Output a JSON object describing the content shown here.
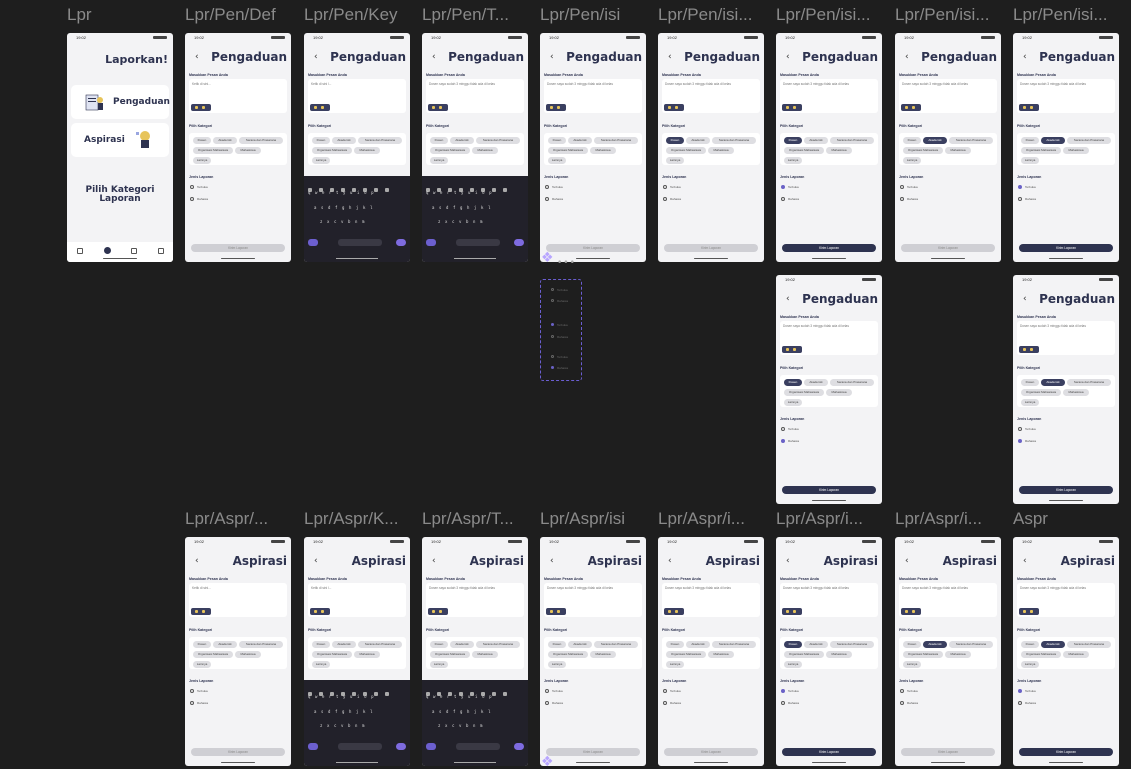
{
  "canvas": {
    "background": "#1e1e1e",
    "accent": "#2e3350",
    "purple_accent": "#6a62c6"
  },
  "frame_labels": {
    "row1": [
      "Lpr",
      "Lpr/Pen/Def",
      "Lpr/Pen/Key",
      "Lpr/Pen/T...",
      "Lpr/Pen/isi",
      "Lpr/Pen/isi...",
      "Lpr/Pen/isi...",
      "Lpr/Pen/isi...",
      "Lpr/Pen/isi..."
    ],
    "row3": [
      "Lpr/Aspr/...",
      "Lpr/Aspr/K...",
      "Lpr/Aspr/T...",
      "Lpr/Aspr/isi",
      "Lpr/Aspr/i...",
      "Lpr/Aspr/i...",
      "Lpr/Aspr/i...",
      "Aspr"
    ]
  },
  "status": {
    "time": "19:02"
  },
  "home": {
    "title": "Laporkan!",
    "card1": "Pengaduan",
    "card2": "Aspirasi",
    "prompt_line1": "Pilih Kategori",
    "prompt_line2": "Laporan"
  },
  "form": {
    "title_pen": "Pengaduan",
    "title_asp": "Aspirasi",
    "msg_label": "Masukkan Pesan Anda",
    "placeholder": "Ketik di sini...",
    "placeholder_short": "Ketik di sini l...",
    "typed": "Dosen saya sudah 3 minggu tidak ada di kelas",
    "cat_label": "Pilih Kategori",
    "cats": [
      "Dosen",
      "Akademik",
      "Sarana dan Prasarana",
      "Organisasi Mahasiswa",
      "Mahasiswa",
      "Lainnya"
    ],
    "type_label": "Jenis Laporan",
    "type_opts": [
      "Terbuka",
      "Rahasia"
    ],
    "submit": "Kirim Laporan"
  },
  "keyboard": {
    "row1": "qwertyuiop",
    "row2": "asdfghjkl",
    "row3": "zxcvbnm",
    "mode": "?123"
  }
}
